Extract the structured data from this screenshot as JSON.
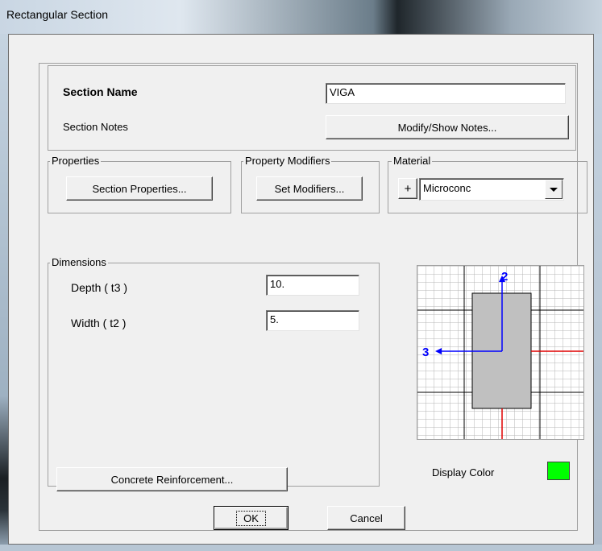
{
  "window": {
    "title": "Rectangular Section"
  },
  "section": {
    "name_label": "Section Name",
    "name_value": "VIGA",
    "notes_label": "Section Notes",
    "notes_button": "Modify/Show Notes..."
  },
  "properties": {
    "group_label": "Properties",
    "button": "Section Properties..."
  },
  "modifiers": {
    "group_label": "Property Modifiers",
    "button": "Set Modifiers..."
  },
  "material": {
    "group_label": "Material",
    "add_button": "+",
    "selected": "Microconc"
  },
  "dimensions": {
    "group_label": "Dimensions",
    "depth_label": "Depth  ( t3 )",
    "depth_value": "10.",
    "width_label": "Width  ( t2 )",
    "width_value": "5."
  },
  "preview": {
    "axis_vertical": "2",
    "axis_horizontal": "3"
  },
  "display_color": {
    "label": "Display Color",
    "color": "#00ff00"
  },
  "buttons": {
    "reinforcement": "Concrete Reinforcement...",
    "ok": "OK",
    "cancel": "Cancel"
  }
}
